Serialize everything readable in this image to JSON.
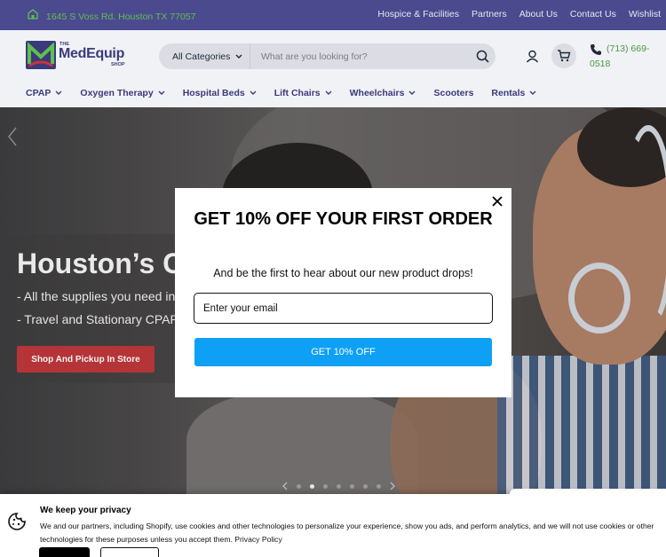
{
  "topbar": {
    "address": "1645 S Voss Rd. Houston TX 77057",
    "links": [
      "Hospice & Facilities",
      "Partners",
      "About Us",
      "Contact Us",
      "Wishlist"
    ]
  },
  "header": {
    "logo": {
      "the": "THE",
      "name": "MedEquip",
      "shop": "SHOP"
    },
    "search": {
      "category": "All Categories",
      "placeholder": "What are you looking for?"
    },
    "phone": "(713) 669-0518"
  },
  "nav": {
    "items": [
      {
        "label": "CPAP",
        "dropdown": true
      },
      {
        "label": "Oxygen Therapy",
        "dropdown": true
      },
      {
        "label": "Hospital Beds",
        "dropdown": true
      },
      {
        "label": "Lift Chairs",
        "dropdown": true
      },
      {
        "label": "Wheelchairs",
        "dropdown": true
      },
      {
        "label": "Scooters",
        "dropdown": false
      },
      {
        "label": "Rentals",
        "dropdown": true
      }
    ]
  },
  "hero": {
    "title": "Houston’s Cl",
    "line1": "- All the supplies you need in st",
    "line2": "- Travel and Stationary CPAP M",
    "cta": "Shop And Pickup In Store",
    "slides": 7,
    "active_slide": 1
  },
  "modal": {
    "title": "GET 10% OFF YOUR FIRST ORDER",
    "subtitle": "And be the first to hear about our new product drops!",
    "email_placeholder": "Enter your email",
    "button": "GET 10% OFF"
  },
  "cookie": {
    "title": "We keep your privacy",
    "text": "We and our partners, including Shopify, use cookies and other technologies to personalize your experience, show you ads, and perform analytics, and we will not use cookies or other technologies for these purposes unless you accept them. Privacy Policy"
  },
  "colors": {
    "topbar_bg": "#4b4a8f",
    "brand": "#3b3a7a",
    "address_green": "#5fbf4f",
    "cta_red": "#b53437",
    "modal_button": "#0ea0f5"
  }
}
